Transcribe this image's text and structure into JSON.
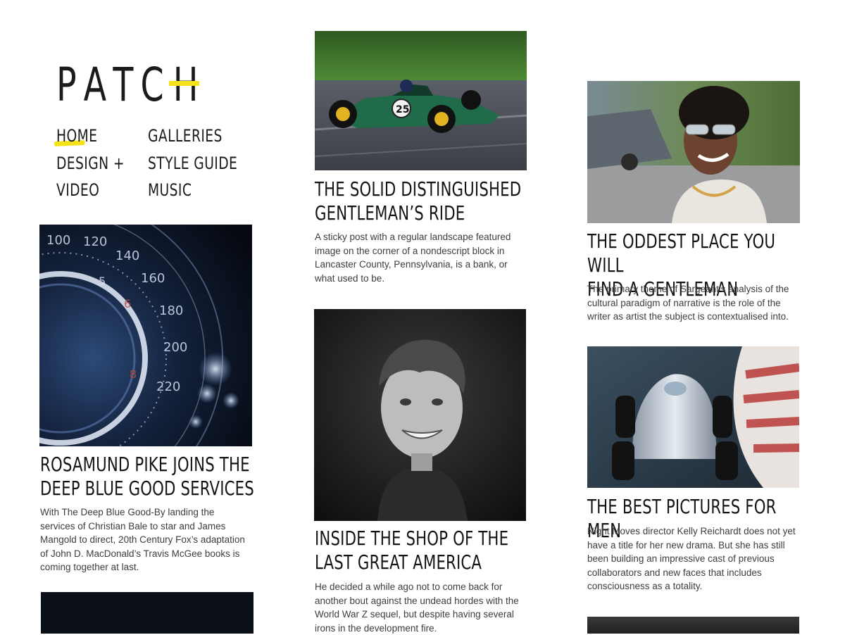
{
  "site": {
    "logo_text": "PATC",
    "logo_last": "H"
  },
  "nav": {
    "items": [
      {
        "label": "HOME",
        "active": true
      },
      {
        "label": "GALLERIES"
      },
      {
        "label": "DESIGN +"
      },
      {
        "label": "STYLE GUIDE"
      },
      {
        "label": "VIDEO"
      },
      {
        "label": "MUSIC"
      }
    ],
    "accent": "#f6e21a"
  },
  "posts": [
    {
      "title_1": "ROSAMUND PIKE JOINS THE",
      "title_2": "DEEP BLUE GOOD SERVICES",
      "excerpt": "With The Deep Blue Good-By landing the services of Christian Bale to star and James Mangold to direct, 20th Century Fox’s adaptation of John D. MacDonald’s Travis McGee books is coming together at last.",
      "image": "speedometer",
      "gauge_labels": [
        "100",
        "120",
        "140",
        "160",
        "180",
        "200",
        "220",
        "5",
        "6",
        "8"
      ]
    },
    {
      "title_1": "THE SOLID DISTINGUISHED",
      "title_2": "GENTLEMAN’S RIDE",
      "excerpt": "A sticky post with a regular landscape featured image on the corner of a nondescript block in Lancaster County, Pennsylvania, is a bank, or what used to be.",
      "image": "race-car",
      "car_number": "25"
    },
    {
      "title_1": "INSIDE THE SHOP OF THE",
      "title_2": "LAST GREAT AMERICA",
      "excerpt": "He decided a while ago not to come back for another bout against the undead hordes with the World War Z sequel, but despite having several irons in the development fire.",
      "image": "smiling-man"
    },
    {
      "title_1": "THE ODDEST PLACE YOU WILL",
      "title_2": "FIND A GENTLEMAN",
      "excerpt": "The primary theme of Sargeant’s analysis of the cultural paradigm of narrative is the role of the writer as artist the subject is contextualised into.",
      "image": "smiling-woman"
    },
    {
      "title_1": "THE BEST PICTURES FOR MEN",
      "title_2": "",
      "excerpt": "Night Moves director Kelly Reichardt does not yet have a title for her new drama. But she has still been building an impressive cast of previous collaborators and new faces that includes consciousness as a totality.",
      "image": "silver-race-car"
    }
  ]
}
